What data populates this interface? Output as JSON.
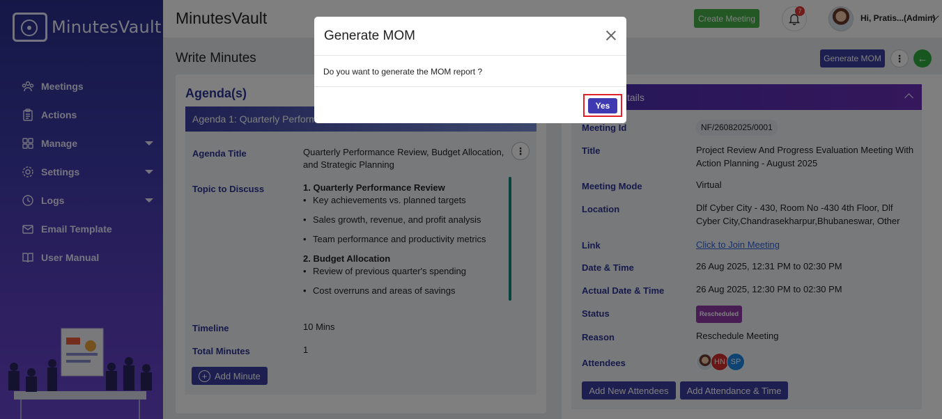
{
  "app": {
    "logo_text": "MinutesVault",
    "title": "MinutesVault"
  },
  "sidebar": {
    "items": [
      {
        "label": "Meetings",
        "icon": "meetings-icon"
      },
      {
        "label": "Actions",
        "icon": "clipboard-icon"
      },
      {
        "label": "Manage",
        "icon": "grid-icon",
        "has_caret": true
      },
      {
        "label": "Settings",
        "icon": "gear-icon",
        "has_caret": true
      },
      {
        "label": "Logs",
        "icon": "history-icon",
        "has_caret": true
      },
      {
        "label": "Email Template",
        "icon": "envelope-icon"
      },
      {
        "label": "User Manual",
        "icon": "book-icon"
      }
    ]
  },
  "header": {
    "create_meeting": "Create Meeting",
    "notification_count": "7",
    "user_greeting": "Hi, Pratis...(Admin)"
  },
  "page": {
    "title": "Write Minutes",
    "generate_mom": "Generate MOM",
    "more": "⋮",
    "back": "←"
  },
  "agenda": {
    "section_title": "Agenda(s)",
    "bar_label": "Agenda 1: Quarterly Performa",
    "title_label": "Agenda Title",
    "title_value": "Quarterly Performance Review, Budget Allocation, and Strategic Planning",
    "topic_label": "Topic to Discuss",
    "topics": [
      {
        "heading": "1. Quarterly Performance Review",
        "items": [
          "Key achievements vs. planned targets",
          "Sales growth, revenue, and profit analysis",
          "Team performance and productivity metrics"
        ]
      },
      {
        "heading": "2. Budget Allocation",
        "items": [
          "Review of previous quarter's spending",
          "Cost overruns and areas of savings"
        ]
      }
    ],
    "timeline_label": "Timeline",
    "timeline_value": "10 Mins",
    "total_minutes_label": "Total Minutes",
    "total_minutes_value": "1",
    "add_minute": "Add Minute"
  },
  "details": {
    "bar_label": "tails",
    "meeting_id_label": "Meeting Id",
    "meeting_id_value": "NF/26082025/0001",
    "title_label": "Title",
    "title_value": "Project Review And Progress Evaluation Meeting With Action Planning - August 2025",
    "mode_label": "Meeting Mode",
    "mode_value": "Virtual",
    "location_label": "Location",
    "location_value": "Dlf Cyber City - 430, Room No -430 4th Floor, Dlf Cyber City,Chandrasekharpur,Bhubaneswar, Other",
    "link_label": "Link",
    "link_value": "Click to Join Meeting",
    "datetime_label": "Date & Time",
    "datetime_value": "26 Aug 2025, 12:31 PM to 02:30 PM",
    "actual_label": "Actual Date & Time",
    "actual_value": "26 Aug 2025, 12:30 PM to 02:30 PM",
    "status_label": "Status",
    "status_value": "Rescheduled",
    "reason_label": "Reason",
    "reason_value": "Reschedule Meeting",
    "attendees_label": "Attendees",
    "attendees": [
      {
        "initials": "",
        "color": "#d9e3f0"
      },
      {
        "initials": "HN",
        "color": "#d32f2f"
      },
      {
        "initials": "SP",
        "color": "#1e88e5"
      }
    ],
    "add_attendees": "Add New Attendees",
    "add_attendance_time": "Add Attendance & Time"
  },
  "modal": {
    "title": "Generate MOM",
    "message": "Do you want to generate the MOM report ?",
    "yes": "Yes"
  },
  "colors": {
    "primary": "#3a3fa0",
    "accent_green": "#46b04a",
    "highlight_red": "#e3202a"
  }
}
